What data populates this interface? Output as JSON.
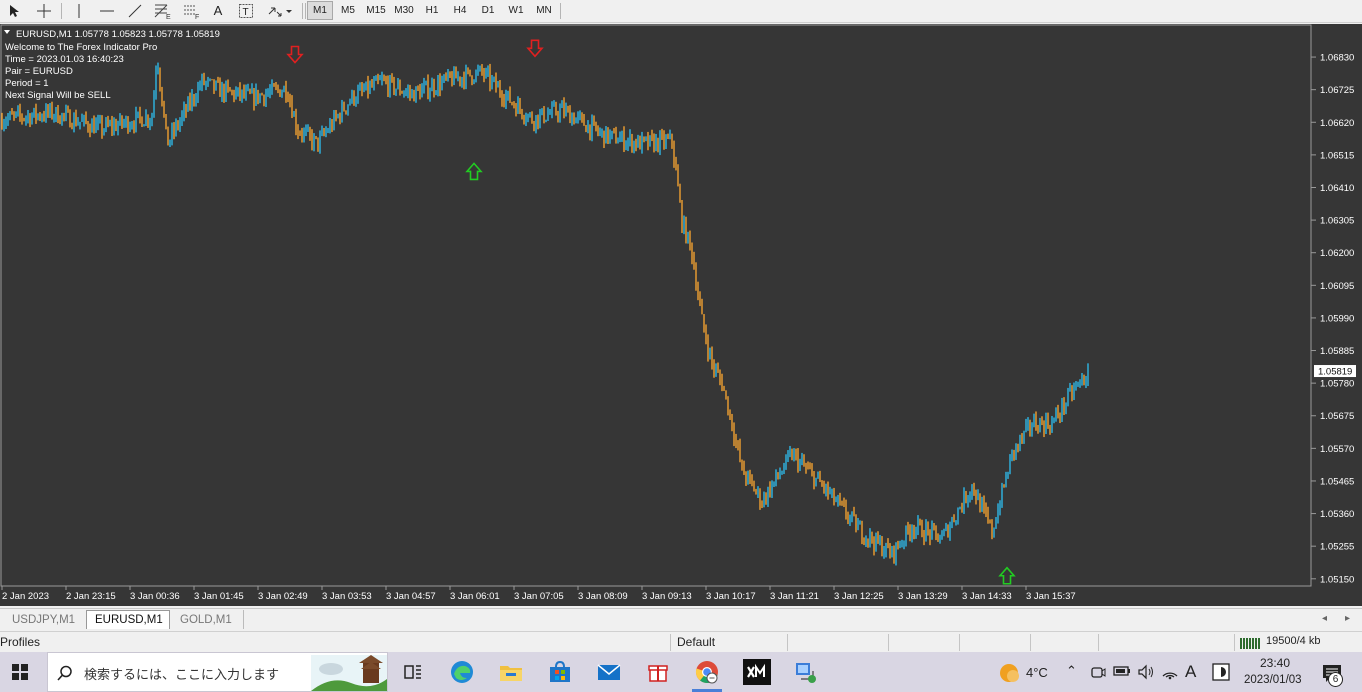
{
  "toolbar": {
    "timeframes": [
      "M1",
      "M5",
      "M15",
      "M30",
      "H1",
      "H4",
      "D1",
      "W1",
      "MN"
    ],
    "active_timeframe": "M1",
    "tools": [
      "cursor-icon",
      "crosshair-icon",
      "vertical-line-icon",
      "horizontal-line-icon",
      "trendline-icon",
      "fibonacci-icon",
      "fibonacci-fan-icon",
      "text-icon",
      "text-label-icon",
      "arrows-icon"
    ],
    "tool_letters": {
      "fibo_a": "E",
      "fibo_b": "F",
      "text": "A",
      "label": "T"
    }
  },
  "chart": {
    "symbol_line": "EURUSD,M1  1.05778 1.05823 1.05778 1.05819",
    "info_lines": [
      "Welcome to The Forex Indicator Pro",
      "Time = 2023.01.03 16:40:23",
      "Pair = EURUSD",
      "Period = 1",
      "Next Signal Will be SELL"
    ],
    "price_levels": [
      "1.06830",
      "1.06725",
      "1.06620",
      "1.06515",
      "1.06410",
      "1.06305",
      "1.06200",
      "1.06095",
      "1.05990",
      "1.05885",
      "1.05780",
      "1.05675",
      "1.05570",
      "1.05465",
      "1.05360",
      "1.05255",
      "1.05150"
    ],
    "current_price": "1.05819",
    "time_labels": [
      "2 Jan 2023",
      "2 Jan 23:15",
      "3 Jan 00:36",
      "3 Jan 01:45",
      "3 Jan 02:49",
      "3 Jan 03:53",
      "3 Jan 04:57",
      "3 Jan 06:01",
      "3 Jan 07:05",
      "3 Jan 08:09",
      "3 Jan 09:13",
      "3 Jan 10:17",
      "3 Jan 11:21",
      "3 Jan 12:25",
      "3 Jan 13:29",
      "3 Jan 14:33",
      "3 Jan 15:37"
    ],
    "colors": {
      "background": "#363636",
      "bull": "#2eb7e6",
      "bear": "#f0a030",
      "sell_arrow": "#e02020",
      "buy_arrow": "#22cc22",
      "text": "#ffffff"
    }
  },
  "chart_data": {
    "type": "line",
    "title": "",
    "xlabel": "",
    "ylabel": "",
    "ylim": [
      1.0513,
      1.0693
    ],
    "x_index_range": [
      0,
      1086
    ],
    "series": [
      {
        "x": [
          0,
          50,
          100,
          150,
          155,
          165,
          200,
          220,
          250,
          285,
          295,
          315,
          350,
          380,
          410,
          450,
          480,
          505,
          530,
          560,
          600,
          640,
          670,
          680,
          690,
          700,
          710,
          720,
          730,
          740,
          760,
          790,
          820,
          860,
          890,
          910,
          940,
          970,
          990,
          1010,
          1030,
          1050,
          1070,
          1086
        ],
        "y": [
          1.0663,
          1.0665,
          1.066,
          1.0664,
          1.0684,
          1.0655,
          1.0675,
          1.0672,
          1.067,
          1.0673,
          1.066,
          1.0655,
          1.067,
          1.0675,
          1.0671,
          1.0676,
          1.0678,
          1.067,
          1.0663,
          1.0666,
          1.0658,
          1.0655,
          1.0656,
          1.063,
          1.062,
          1.0598,
          1.0584,
          1.0578,
          1.0565,
          1.055,
          1.054,
          1.0555,
          1.0545,
          1.053,
          1.0523,
          1.0532,
          1.0528,
          1.0545,
          1.053,
          1.0555,
          1.0565,
          1.0565,
          1.0575,
          1.0581
        ]
      }
    ],
    "signals": [
      {
        "type": "sell",
        "time_index": 293,
        "price": 1.06835
      },
      {
        "type": "sell",
        "time_index": 533,
        "price": 1.06855
      },
      {
        "type": "buy",
        "time_index": 472,
        "price": 1.06465
      },
      {
        "type": "buy",
        "time_index": 1005,
        "price": 1.05163
      }
    ]
  },
  "tabs": {
    "items": [
      "USDJPY,M1",
      "EURUSD,M1",
      "GOLD,M1"
    ],
    "active": "EURUSD,M1"
  },
  "status": {
    "profiles": "Profiles",
    "profile_name": "Default",
    "traffic": "19500/4 kb"
  },
  "taskbar": {
    "search_placeholder": "検索するには、ここに入力します",
    "weather": "4°C",
    "time": "23:40",
    "date": "2023/01/03",
    "notifications": "6",
    "ime": "A",
    "apps": [
      "task-view-icon",
      "edge-icon",
      "file-explorer-icon",
      "store-icon",
      "mail-icon",
      "gift-icon",
      "chrome-icon",
      "xm-icon",
      "network-app-icon"
    ]
  }
}
